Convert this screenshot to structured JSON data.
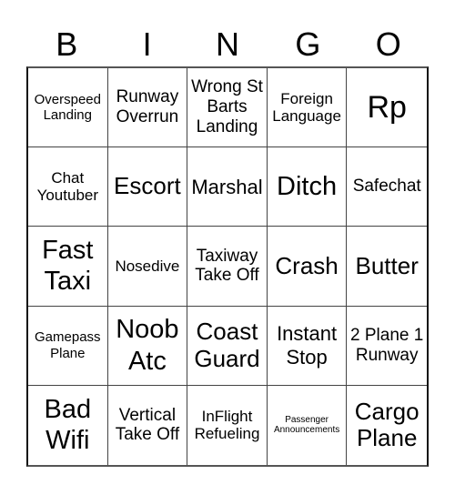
{
  "header": {
    "letters": [
      "B",
      "I",
      "N",
      "G",
      "O"
    ]
  },
  "cells": [
    "Overspeed Landing",
    "Runway Overrun",
    "Wrong St Barts Landing",
    "Foreign Language",
    "Rp",
    "Chat Youtuber",
    "Escort",
    "Marshal",
    "Ditch",
    "Safechat",
    "Fast Taxi",
    "Nosedive",
    "Taxiway Take Off",
    "Crash",
    "Butter",
    "Gamepass Plane",
    "Noob Atc",
    "Coast Guard",
    "Instant Stop",
    "2 Plane 1 Runway",
    "Bad Wifi",
    "Vertical Take Off",
    "InFlight Refueling",
    "Passenger Announcements",
    "Cargo Plane"
  ]
}
